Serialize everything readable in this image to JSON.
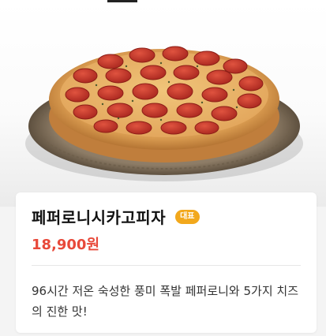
{
  "product": {
    "name": "페퍼로니시카고피자",
    "badge": "대표",
    "price": "18,900원",
    "description": "96시간 저온 숙성한 풍미 폭발 페퍼로니와 5가지 치즈의 진한 맛!"
  },
  "colors": {
    "price": "#e8493a",
    "badge": "#f2a81c",
    "crust": "#d89a4f",
    "pepperoni": "#c3382c",
    "tray": "#8f7d63"
  },
  "icons": {
    "hero_image": "pepperoni-chicago-pizza-image"
  }
}
